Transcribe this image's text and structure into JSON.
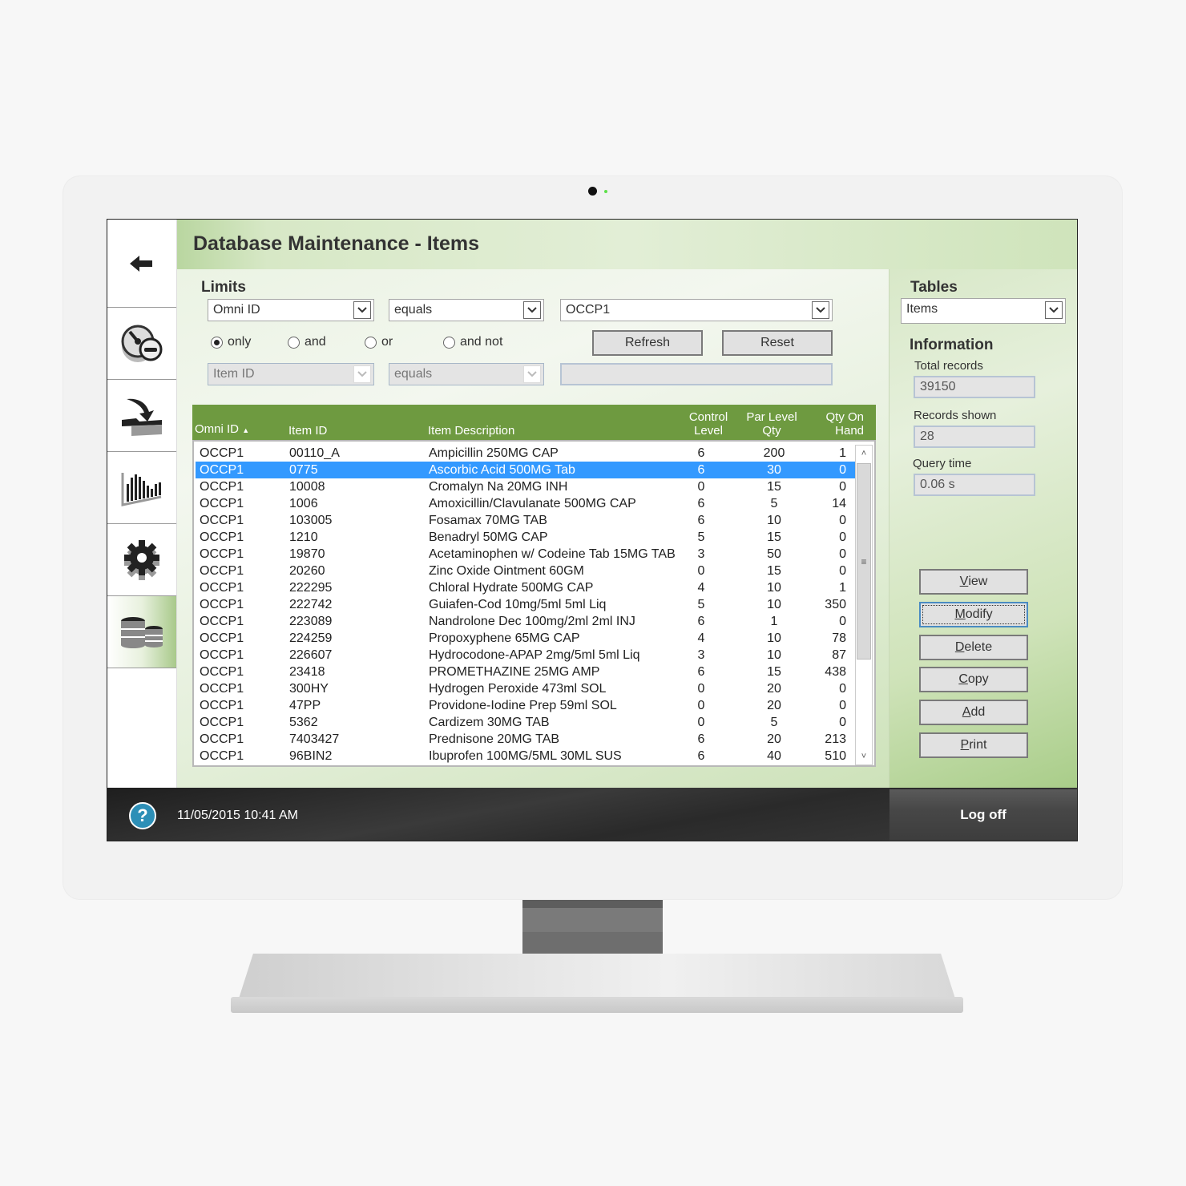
{
  "window": {
    "title": "Database Maintenance - Items"
  },
  "sidebar": {
    "items": [
      {
        "icon": "back-arrow-icon",
        "label": "Back"
      },
      {
        "icon": "gauge-dashboard-icon",
        "label": "Dashboard"
      },
      {
        "icon": "import-icon",
        "label": "Import"
      },
      {
        "icon": "bar-chart-icon",
        "label": "Reports"
      },
      {
        "icon": "gear-icon",
        "label": "Settings"
      },
      {
        "icon": "database-icon",
        "label": "Database",
        "active": true
      }
    ]
  },
  "limits": {
    "label": "Limits",
    "field1": "Omni ID",
    "operator1": "equals",
    "value1": "OCCP1",
    "radios": [
      {
        "label": "only",
        "checked": true
      },
      {
        "label": "and",
        "checked": false
      },
      {
        "label": "or",
        "checked": false
      },
      {
        "label": "and not",
        "checked": false
      }
    ],
    "refresh_label": "Refresh",
    "reset_label": "Reset",
    "field2": "Item ID",
    "operator2": "equals",
    "value2": ""
  },
  "grid": {
    "columns": [
      "Omni ID",
      "Item ID",
      "Item Description",
      "Control Level",
      "Par Level Qty",
      "Qty On Hand"
    ],
    "column_lines": [
      [
        "Omni ID"
      ],
      [
        "Item ID"
      ],
      [
        "Item Description"
      ],
      [
        "Control",
        "Level"
      ],
      [
        "Par Level",
        "Qty"
      ],
      [
        "Qty On",
        "Hand"
      ]
    ],
    "sort_indicator": "▲",
    "selected_index": 1,
    "rows": [
      [
        "OCCP1",
        "00110_A",
        "Ampicillin 250MG CAP",
        "6",
        "200",
        "1"
      ],
      [
        "OCCP1",
        "0775",
        "Ascorbic Acid 500MG Tab",
        "6",
        "30",
        "0"
      ],
      [
        "OCCP1",
        "10008",
        "Cromalyn Na 20MG INH",
        "0",
        "15",
        "0"
      ],
      [
        "OCCP1",
        "1006",
        "Amoxicillin/Clavulanate 500MG CAP",
        "6",
        "5",
        "14"
      ],
      [
        "OCCP1",
        "103005",
        "Fosamax 70MG TAB",
        "6",
        "10",
        "0"
      ],
      [
        "OCCP1",
        "1210",
        "Benadryl 50MG CAP",
        "5",
        "15",
        "0"
      ],
      [
        "OCCP1",
        "19870",
        "Acetaminophen w/ Codeine Tab 15MG TAB",
        "3",
        "50",
        "0"
      ],
      [
        "OCCP1",
        "20260",
        "Zinc Oxide Ointment 60GM",
        "0",
        "15",
        "0"
      ],
      [
        "OCCP1",
        "222295",
        "Chloral Hydrate 500MG CAP",
        "4",
        "10",
        "1"
      ],
      [
        "OCCP1",
        "222742",
        "Guiafen-Cod 10mg/5ml 5ml Liq",
        "5",
        "10",
        "350"
      ],
      [
        "OCCP1",
        "223089",
        "Nandrolone Dec 100mg/2ml 2ml INJ",
        "6",
        "1",
        "0"
      ],
      [
        "OCCP1",
        "224259",
        "Propoxyphene 65MG CAP",
        "4",
        "10",
        "78"
      ],
      [
        "OCCP1",
        "226607",
        "Hydrocodone-APAP 2mg/5ml 5ml Liq",
        "3",
        "10",
        "87"
      ],
      [
        "OCCP1",
        "23418",
        "PROMETHAZINE 25MG AMP",
        "6",
        "15",
        "438"
      ],
      [
        "OCCP1",
        "300HY",
        "Hydrogen Peroxide 473ml SOL",
        "0",
        "20",
        "0"
      ],
      [
        "OCCP1",
        "47PP",
        "Providone-Iodine Prep 59ml SOL",
        "0",
        "20",
        "0"
      ],
      [
        "OCCP1",
        "5362",
        "Cardizem 30MG TAB",
        "0",
        "5",
        "0"
      ],
      [
        "OCCP1",
        "7403427",
        "Prednisone 20MG TAB",
        "6",
        "20",
        "213"
      ],
      [
        "OCCP1",
        "96BIN2",
        "Ibuprofen 100MG/5ML 30ML SUS",
        "6",
        "40",
        "510"
      ]
    ]
  },
  "tables": {
    "label": "Tables",
    "selected": "Items"
  },
  "information": {
    "label": "Information",
    "total_records_label": "Total records",
    "total_records": "39150",
    "records_shown_label": "Records shown",
    "records_shown": "28",
    "query_time_label": "Query time",
    "query_time": "0.06 s"
  },
  "actions": [
    {
      "label": "View",
      "key": "V"
    },
    {
      "label": "Modify",
      "key": "M",
      "focused": true
    },
    {
      "label": "Delete",
      "key": "D"
    },
    {
      "label": "Copy",
      "key": "C"
    },
    {
      "label": "Add",
      "key": "A"
    },
    {
      "label": "Print",
      "key": "P"
    }
  ],
  "footer": {
    "help_icon": "?",
    "datetime": "11/05/2015  10:41 AM",
    "logoff_label": "Log off"
  },
  "colors": {
    "header_green": "#6e9a40",
    "selection_blue": "#3399ff",
    "help_blue": "#2d8fb7"
  }
}
